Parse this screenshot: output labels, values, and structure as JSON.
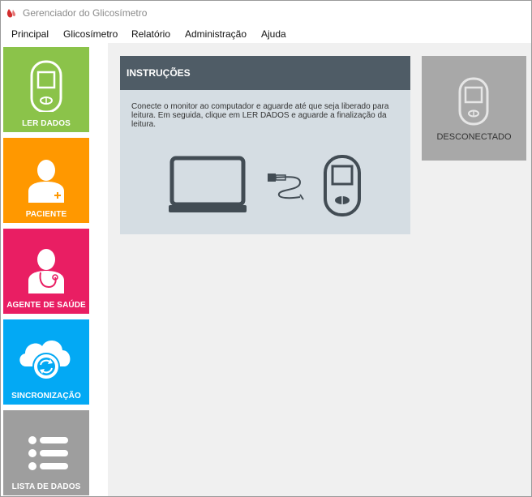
{
  "window": {
    "title": "Gerenciador do Glicosímetro"
  },
  "menu": [
    "Principal",
    "Glicosímetro",
    "Relatório",
    "Administração",
    "Ajuda"
  ],
  "sidebar": {
    "tiles": [
      {
        "label": "LER DADOS",
        "color": "#8bc34a",
        "icon": "glucometer-icon"
      },
      {
        "label": "PACIENTE",
        "color": "#ff9800",
        "icon": "patient-icon"
      },
      {
        "label": "AGENTE DE SAÚDE",
        "color": "#e91e63",
        "icon": "health-agent-icon"
      },
      {
        "label": "SINCRONIZAÇÃO",
        "color": "#03a9f4",
        "icon": "sync-cloud-icon"
      },
      {
        "label": "LISTA DE DADOS",
        "color": "#9e9e9e",
        "icon": "list-icon"
      }
    ]
  },
  "instructions": {
    "title": "INSTRUÇÕES",
    "text": "Conecte o monitor ao computador e aguarde até que seja liberado para leitura. Em seguida, clique em LER DADOS e aguarde a finalização da leitura."
  },
  "status": {
    "label": "DESCONECTADO"
  }
}
